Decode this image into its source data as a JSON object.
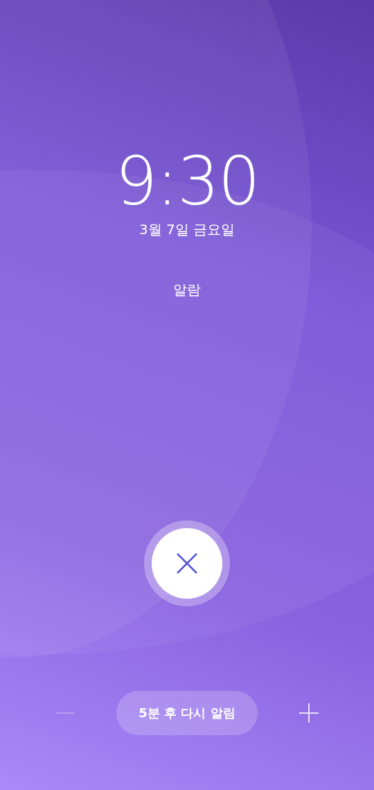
{
  "clock": {
    "time": "9:30",
    "date": "3월 7일 금요일",
    "label": "알람"
  },
  "snooze": {
    "decrease_disabled": true,
    "button": "5분 후 다시 알림",
    "increase_disabled": false
  }
}
